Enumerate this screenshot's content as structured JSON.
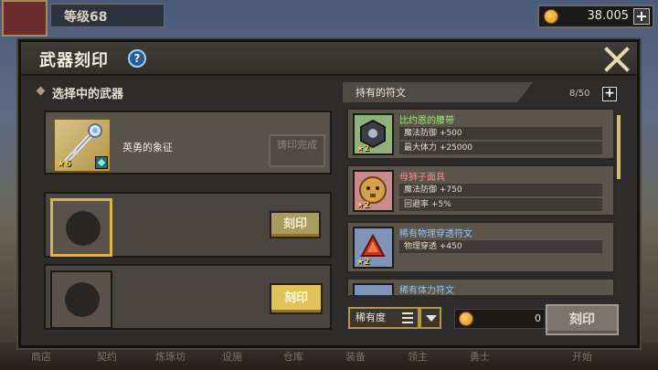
{
  "header_bg": {
    "level_label": "等级68",
    "gold_amount": "38.005"
  },
  "bg_nav": [
    "商店",
    "契约",
    "炼琢坊",
    "设施",
    "仓库",
    "装备",
    "领主",
    "勇士",
    "开始"
  ],
  "dialog": {
    "title": "武器刻印",
    "help_glyph": "?"
  },
  "left": {
    "section_title": "选择中的武器",
    "weapon": {
      "name": "英勇的象征",
      "stars": "6"
    },
    "done_button": "铸印完成",
    "engrave_label": "刻印"
  },
  "right": {
    "tab_title": "持有的符文",
    "count": "8/50",
    "runes": [
      {
        "name": "比约恩的腰带",
        "name_color": "#9cf07a",
        "stars": "2",
        "stats": [
          "魔法防御 +500",
          "最大体力 +25000"
        ]
      },
      {
        "name": "母狮子面具",
        "name_color": "#ff8a8a",
        "stars": "2",
        "stats": [
          "魔法防御 +750",
          "回避率 +5%"
        ]
      },
      {
        "name": "稀有物理穿透符文",
        "name_color": "#8fc8ff",
        "stars": "2",
        "stats": [
          "物理穿透 +450"
        ]
      },
      {
        "name": "稀有体力符文",
        "name_color": "#8fc8ff",
        "stars": "",
        "stats": []
      }
    ]
  },
  "bottom": {
    "rarity_label": "稀有度",
    "cost_value": "0",
    "engrave_button": "刻印"
  }
}
